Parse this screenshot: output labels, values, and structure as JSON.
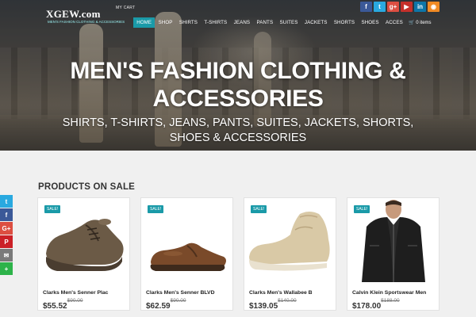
{
  "header": {
    "logo": "XGEW.com",
    "logo_tagline": "MEN'S FASHION CLOTHING & ACCESSORIES",
    "my_cart": "MY CART",
    "nav": [
      {
        "label": "HOME",
        "active": true
      },
      {
        "label": "SHOP"
      },
      {
        "label": "SHIRTS"
      },
      {
        "label": "T-SHIRTS"
      },
      {
        "label": "JEANS"
      },
      {
        "label": "PANTS"
      },
      {
        "label": "SUITES"
      },
      {
        "label": "JACKETS"
      },
      {
        "label": "SHORTS"
      },
      {
        "label": "SHOES"
      },
      {
        "label": "ACCES"
      }
    ],
    "cart_label": "0 items",
    "social_icons": [
      "facebook-icon",
      "twitter-icon",
      "google-plus-icon",
      "youtube-icon",
      "linkedin-icon",
      "rss-icon"
    ]
  },
  "hero": {
    "title_line1": "MEN'S FASHION CLOTHING &",
    "title_line2": "ACCESSORIES",
    "subtitle_line1": "SHIRTS, T-SHIRTS, JEANS, PANTS, SUITES, JACKETS, SHORTS,",
    "subtitle_line2": "SHOES & ACCESSORIES"
  },
  "products_section": {
    "title": "PRODUCTS ON SALE",
    "badge": "SALE!",
    "products": [
      {
        "name": "Clarks Men's Senner Plac",
        "price": "$55.52",
        "old_price": "$90.00",
        "image": "brown-shoe"
      },
      {
        "name": "Clarks Men's Senner BLVD",
        "price": "$62.59",
        "old_price": "$90.00",
        "image": "brown-oxford-shoe"
      },
      {
        "name": "Clarks Men's Wallabee B",
        "price": "$139.05",
        "old_price": "$140.00",
        "image": "beige-wallabee-boot"
      },
      {
        "name": "Calvin Klein Sportswear Men",
        "price": "$178.00",
        "old_price": "$188.00",
        "image": "leather-jacket"
      }
    ]
  },
  "share_bar": [
    "twitter-icon",
    "facebook-icon",
    "google-plus-icon",
    "pinterest-icon",
    "email-icon",
    "more-icon"
  ],
  "colors": {
    "accent": "#1a9aa8",
    "facebook": "#3b5998",
    "twitter": "#29a9e0",
    "google": "#dc4e41",
    "youtube": "#c4302b",
    "linkedin": "#0e76a8",
    "rss": "#f08a24"
  }
}
